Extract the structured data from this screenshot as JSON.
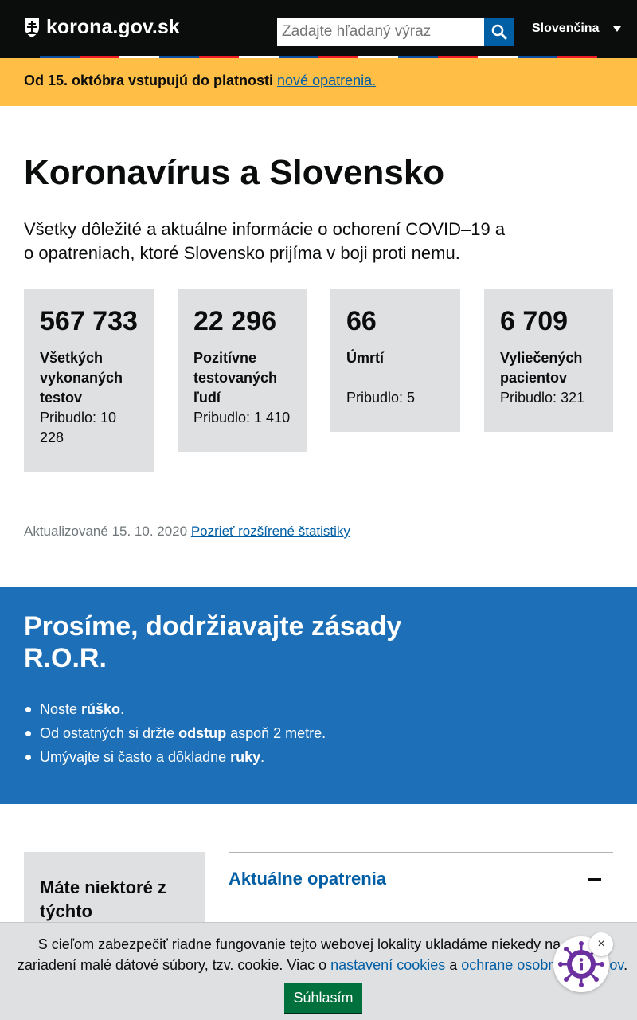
{
  "header": {
    "logo_text": "korona.gov.sk",
    "search_placeholder": "Zadajte hľadaný výraz",
    "language": "Slovenčina"
  },
  "colors": {
    "header_bg": "#0b0c0c",
    "notice_bg": "#ffbf47",
    "ror_bg": "#1d70b8",
    "link": "#005ea5",
    "card_bg": "#dee0e2",
    "accept_button": "#00703c",
    "flag_blue": "#0b4ea2",
    "flag_red": "#ee1c25"
  },
  "notice": {
    "text": "Od 15. októbra vstupujú do platnosti",
    "link_text": "nové opatrenia."
  },
  "hero": {
    "title": "Koronavírus a Slovensko",
    "lead": "Všetky dôležité a aktuálne informácie o ochorení COVID–19 a o opatreniach, ktoré Slovensko prijíma v boji proti nemu."
  },
  "stats": [
    {
      "value": "567 733",
      "label": "Všetkých vykonaných testov",
      "added": "Pribudlo: 10 228"
    },
    {
      "value": "22 296",
      "label": "Pozitívne testovaných ľudí",
      "added": "Pribudlo: 1 410"
    },
    {
      "value": "66",
      "label": "Úmrtí",
      "added": "Pribudlo: 5"
    },
    {
      "value": "6 709",
      "label": "Vyliečených pacientov",
      "added": "Pribudlo: 321"
    }
  ],
  "updated": {
    "text": "Aktualizované 15. 10. 2020",
    "link_text": "Pozrieť rozšírené štatistiky"
  },
  "ror": {
    "title": "Prosíme, dodržiavajte zásady R.O.R.",
    "items": [
      {
        "before": "Noste ",
        "bold": "rúško",
        "after": "."
      },
      {
        "before": "Od ostatných si držte ",
        "bold": "odstup",
        "after": " aspoň 2 metre."
      },
      {
        "before": "Umývajte si často a dôkladne ",
        "bold": "ruky",
        "after": "."
      }
    ]
  },
  "sidebar": {
    "title": "Máte niektoré z týchto"
  },
  "accordion": {
    "title": "Aktuálne opatrenia"
  },
  "cookie": {
    "text_before": "S cieľom zabezpečiť riadne fungovanie tejto webovej lokality ukladáme niekedy na vašom zariadení malé dátové súbory, tzv. cookie. Viac o ",
    "link1": "nastavení cookies",
    "middle": " a ",
    "link2": "ochrane osobných údajov",
    "after": ".",
    "accept_label": "Súhlasím",
    "close_glyph": "×"
  }
}
